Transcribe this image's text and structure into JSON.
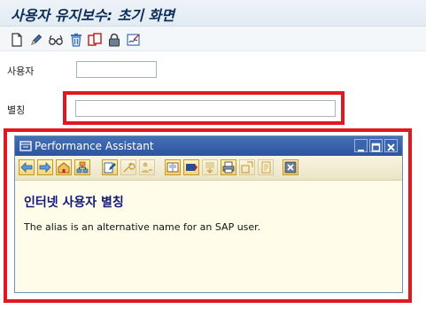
{
  "title": "사용자 유지보수: 초기 화면",
  "toolbar": {
    "icons": [
      "new-page-icon",
      "pencil-icon",
      "glasses-icon",
      "trash-icon",
      "copy-icon",
      "lock-icon",
      "signature-icon"
    ]
  },
  "fields": {
    "user": {
      "label": "사용자",
      "value": ""
    },
    "alias": {
      "label": "별칭",
      "value": ""
    }
  },
  "assistant": {
    "title": "Performance Assistant",
    "heading": "인터넷 사용자 별칭",
    "text": "The alias is an alternative name for an SAP user."
  },
  "colors": {
    "highlight": "#e01820",
    "title": "#0b2e59",
    "assistant_titlebar": "#2c54a0",
    "assistant_heading": "#121978",
    "assistant_background": "#fffde9"
  }
}
